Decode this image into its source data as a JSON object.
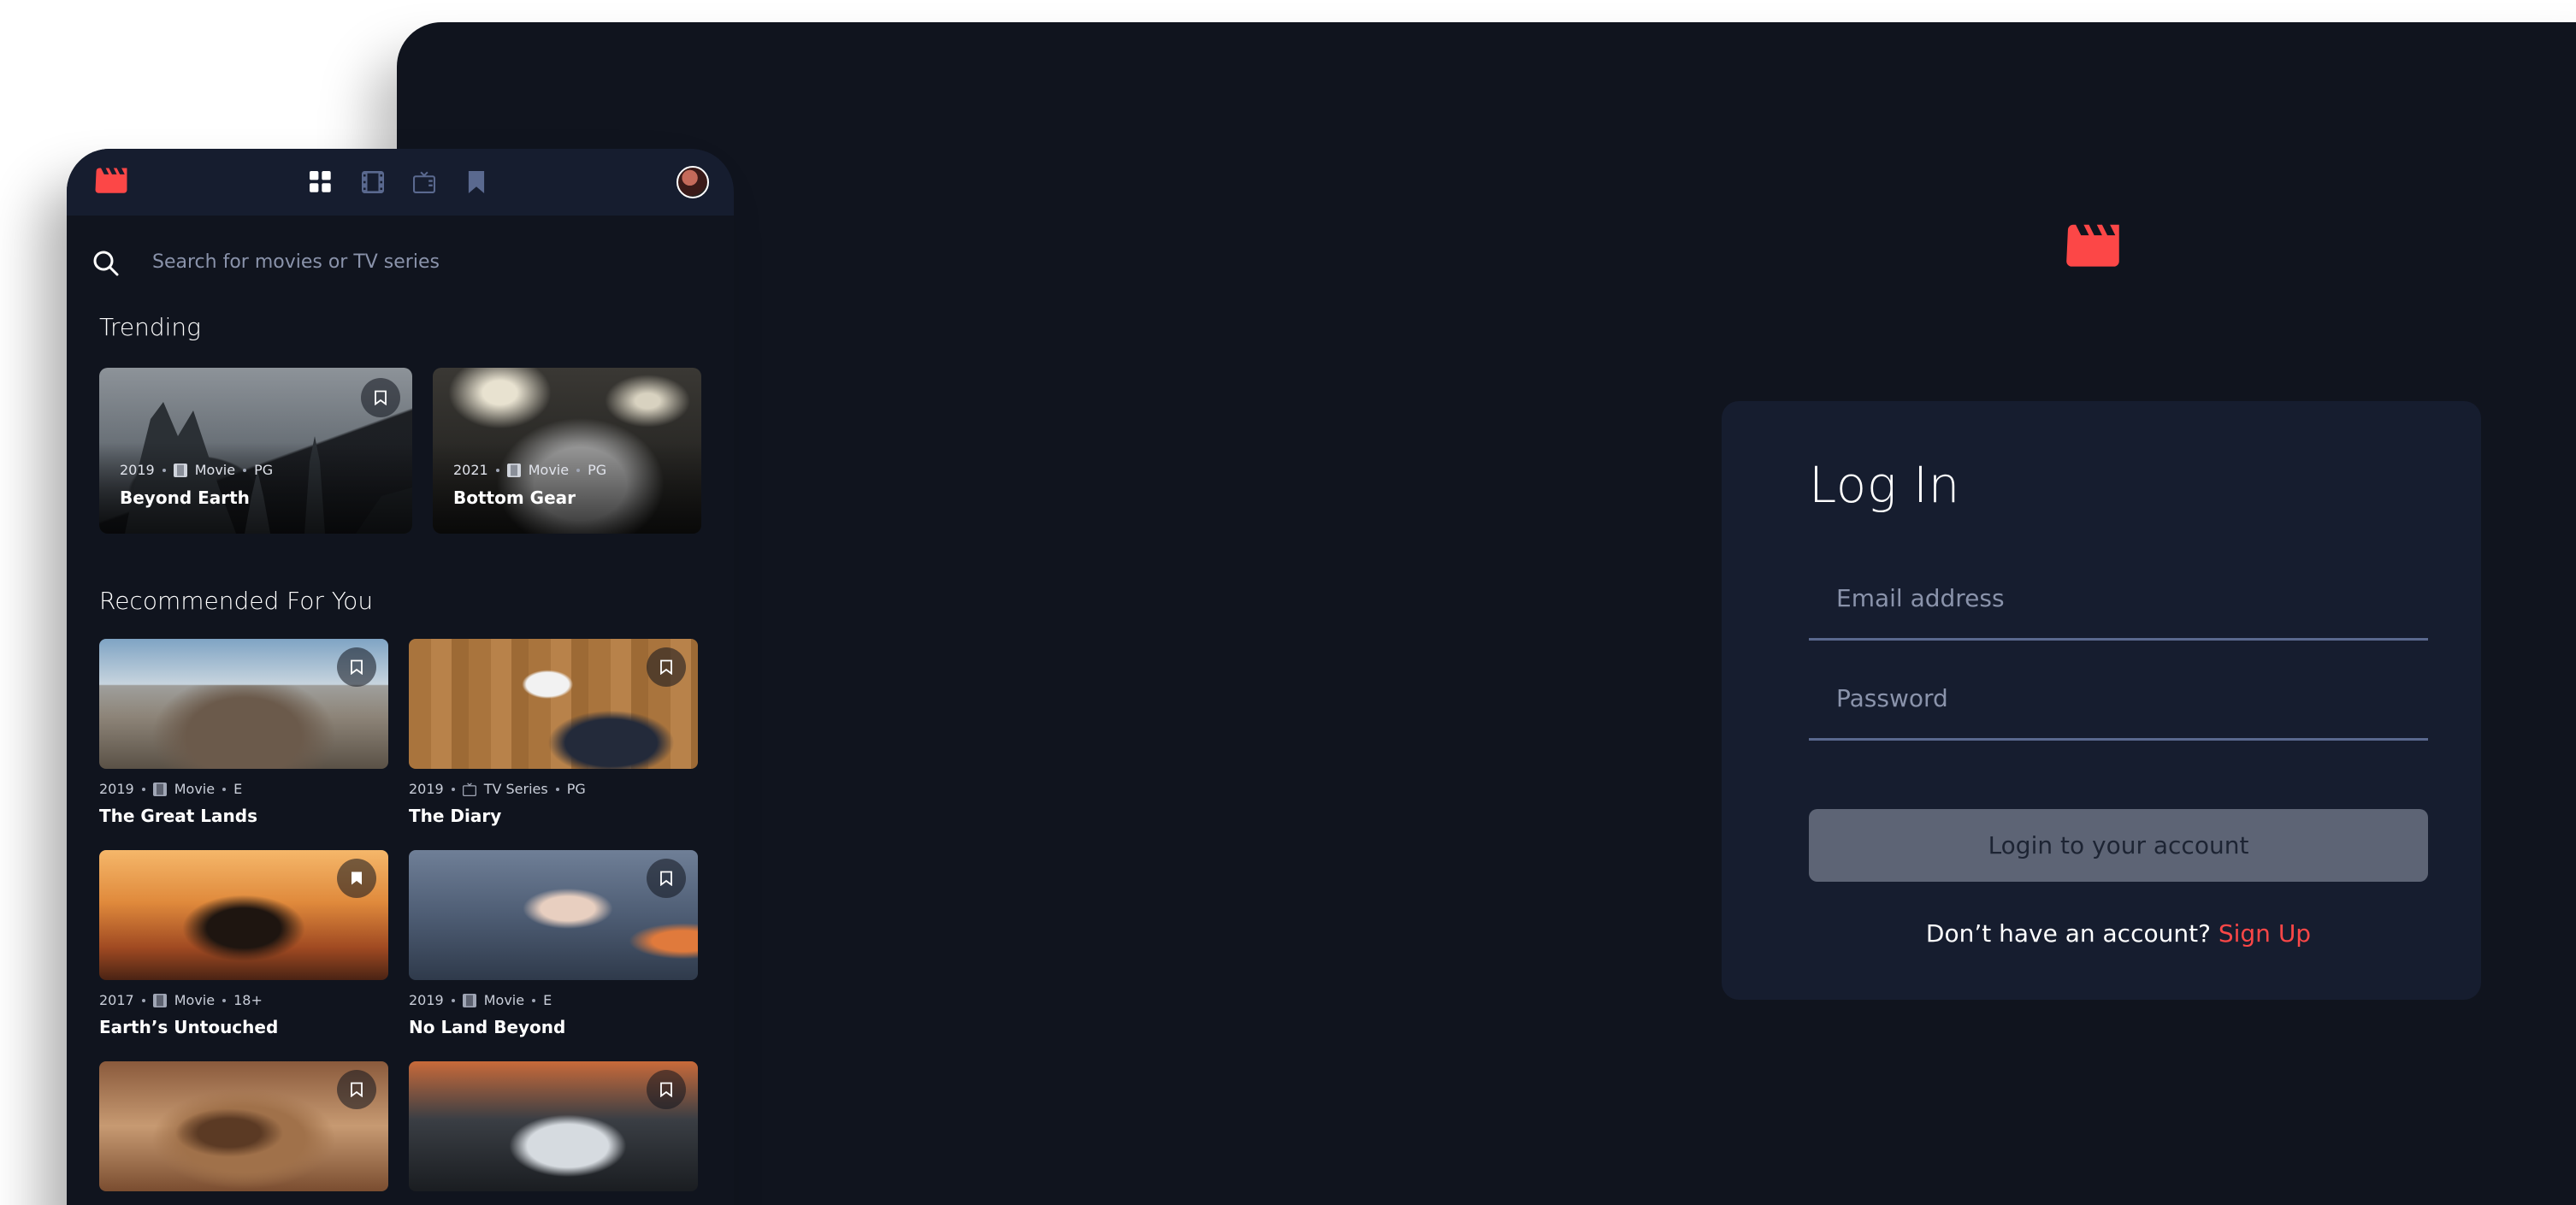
{
  "mobile": {
    "search_placeholder": "Search for movies or TV series",
    "trending_title": "Trending",
    "recommended_title": "Recommended For You",
    "trending": [
      {
        "year": "2019",
        "category": "Movie",
        "rating": "PG",
        "title": "Beyond Earth"
      },
      {
        "year": "2021",
        "category": "Movie",
        "rating": "PG",
        "title": "Bottom Gear"
      }
    ],
    "recommended": [
      {
        "year": "2019",
        "category": "Movie",
        "rating": "E",
        "title": "The Great Lands"
      },
      {
        "year": "2019",
        "category": "TV Series",
        "rating": "PG",
        "title": "The Diary"
      },
      {
        "year": "2017",
        "category": "Movie",
        "rating": "18+",
        "title": "Earth’s Untouched"
      },
      {
        "year": "2019",
        "category": "Movie",
        "rating": "E",
        "title": "No Land Beyond"
      },
      {
        "year": "",
        "category": "",
        "rating": "",
        "title": ""
      },
      {
        "year": "",
        "category": "",
        "rating": "",
        "title": ""
      }
    ]
  },
  "login": {
    "title": "Log In",
    "email_placeholder": "Email address",
    "password_placeholder": "Password",
    "button_label": "Login to your account",
    "signup_prompt": "Don’t have an account?",
    "signup_link": "Sign Up"
  },
  "icons": {
    "logo": "film-clapper-icon",
    "nav": [
      "grid-home-icon",
      "film-icon",
      "tv-icon",
      "bookmark-icon"
    ],
    "search": "search-icon",
    "bookmark": "bookmark-icon"
  },
  "colors": {
    "background": "#10141e",
    "surface": "#161d2f",
    "accent": "#fc4747",
    "muted": "#5a698f",
    "white": "#ffffff"
  }
}
